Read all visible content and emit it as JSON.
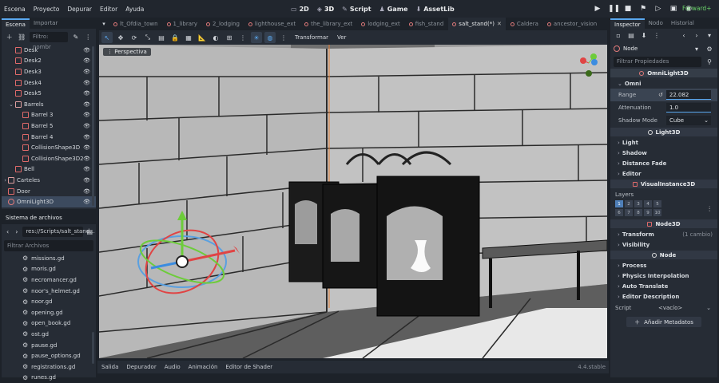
{
  "menubar": {
    "items": [
      "Escena",
      "Proyecto",
      "Depurar",
      "Editor",
      "Ayuda"
    ],
    "workspaces": [
      {
        "label": "2D",
        "icon": "2d-icon"
      },
      {
        "label": "3D",
        "icon": "3d-icon"
      },
      {
        "label": "Script",
        "icon": "script-icon"
      },
      {
        "label": "Game",
        "icon": "game-icon"
      },
      {
        "label": "AssetLib",
        "icon": "assetlib-icon"
      }
    ],
    "renderer": "Forward+"
  },
  "scene_dock": {
    "tabs": [
      "Escena",
      "Importar"
    ],
    "filter_placeholder": "Filtro: nombr",
    "nodes": [
      {
        "name": "Desk",
        "depth": 1,
        "type": "node"
      },
      {
        "name": "Desk2",
        "depth": 1,
        "type": "node"
      },
      {
        "name": "Desk3",
        "depth": 1,
        "type": "node"
      },
      {
        "name": "Desk4",
        "depth": 1,
        "type": "node"
      },
      {
        "name": "Desk5",
        "depth": 1,
        "type": "node"
      },
      {
        "name": "Barrels",
        "depth": 1,
        "type": "folder"
      },
      {
        "name": "Barrel 3",
        "depth": 2,
        "type": "node"
      },
      {
        "name": "Barrel 5",
        "depth": 2,
        "type": "node"
      },
      {
        "name": "Barrel 4",
        "depth": 2,
        "type": "node"
      },
      {
        "name": "CollisionShape3D",
        "depth": 2,
        "type": "node"
      },
      {
        "name": "CollisionShape3D2",
        "depth": 2,
        "type": "node"
      },
      {
        "name": "Bell",
        "depth": 1,
        "type": "node"
      },
      {
        "name": "Carteles",
        "depth": 0,
        "type": "folder"
      },
      {
        "name": "Door",
        "depth": 0,
        "type": "node"
      },
      {
        "name": "OmniLight3D",
        "depth": 0,
        "type": "light"
      }
    ]
  },
  "filesystem": {
    "title": "Sistema de archivos",
    "path": "res://Scripts/salt_stand...",
    "filter_placeholder": "Filtrar Archivos",
    "files": [
      "missions.gd",
      "moris.gd",
      "necromancer.gd",
      "noor's_helmet.gd",
      "noor.gd",
      "opening.gd",
      "open_book.gd",
      "ost.gd",
      "pause.gd",
      "pause_options.gd",
      "registrations.gd",
      "runes.gd"
    ]
  },
  "scene_tabs": [
    "lt_Ofdia_town",
    "1_library",
    "2_lodging",
    "lighthouse_ext",
    "the_library_ext",
    "lodging_ext",
    "fish_stand",
    "salt_stand(*)",
    "Caldera",
    "ancestor_vision"
  ],
  "viewport": {
    "transform_menu": "Transformar",
    "view_menu": "Ver",
    "perspective": "Perspectiva"
  },
  "bottom": {
    "tabs": [
      "Salida",
      "Depurador",
      "Audio",
      "Animación",
      "Editor de Shader"
    ],
    "version": "4.4.stable"
  },
  "inspector": {
    "tabs": [
      "Inspector",
      "Nodo",
      "Historial"
    ],
    "node": "Node",
    "filter_placeholder": "Filtrar Propiedades",
    "class_header": "OmniLight3D",
    "omni_label": "Omni",
    "range_label": "Range",
    "range_value": "22.082",
    "attenuation_label": "Attenuation",
    "attenuation_value": "1.0",
    "shadow_mode_label": "Shadow Mode",
    "shadow_mode_value": "Cube",
    "light3d": "Light3D",
    "light_groups": [
      "Light",
      "Shadow",
      "Distance Fade",
      "Editor"
    ],
    "visual": "VisualInstance3D",
    "layers_label": "Layers",
    "layers": [
      "1",
      "2",
      "3",
      "4",
      "5",
      "6",
      "7",
      "8",
      "9",
      "10"
    ],
    "node3d": "Node3D",
    "transform": "Transform",
    "transform_note": "(1 cambio)",
    "visibility": "Visibility",
    "node_groups": [
      "Process",
      "Physics Interpolation",
      "Auto Translate",
      "Editor Description"
    ],
    "script_label": "Script",
    "script_value": "<vacío>",
    "add_meta": "Añadir Metadatos"
  }
}
